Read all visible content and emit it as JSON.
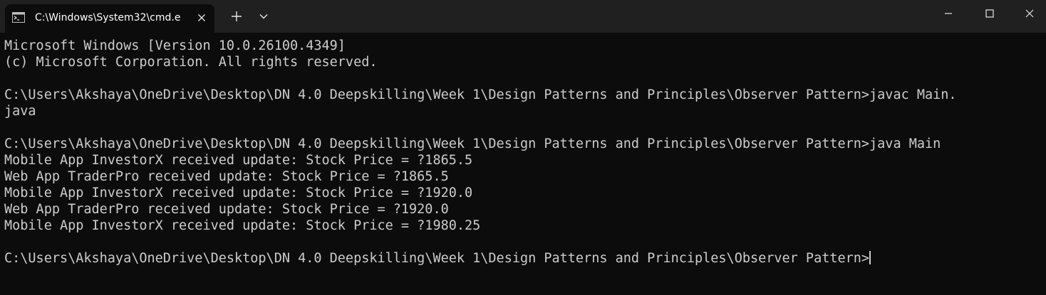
{
  "tab": {
    "icon": "command-prompt-icon",
    "title": "C:\\Windows\\System32\\cmd.e"
  },
  "titlebar_icons": {
    "close_tab": "close-icon",
    "new_tab": "plus-icon",
    "dropdown": "chevron-down-icon",
    "minimize": "minimize-icon",
    "maximize": "maximize-icon",
    "close_window": "close-icon"
  },
  "console": {
    "header": [
      "Microsoft Windows [Version 10.0.26100.4349]",
      "(c) Microsoft Corporation. All rights reserved."
    ],
    "command1": [
      "C:\\Users\\Akshaya\\OneDrive\\Desktop\\DN 4.0 Deepskilling\\Week 1\\Design Patterns and Principles\\Observer Pattern>javac Main.",
      "java"
    ],
    "command2": "C:\\Users\\Akshaya\\OneDrive\\Desktop\\DN 4.0 Deepskilling\\Week 1\\Design Patterns and Principles\\Observer Pattern>java Main",
    "output": [
      "Mobile App InvestorX received update: Stock Price = ?1865.5",
      "Web App TraderPro received update: Stock Price = ?1865.5",
      "Mobile App InvestorX received update: Stock Price = ?1920.0",
      "Web App TraderPro received update: Stock Price = ?1920.0",
      "Mobile App InvestorX received update: Stock Price = ?1980.25"
    ],
    "prompt": "C:\\Users\\Akshaya\\OneDrive\\Desktop\\DN 4.0 Deepskilling\\Week 1\\Design Patterns and Principles\\Observer Pattern>"
  },
  "colors": {
    "background": "#0c0c0c",
    "titlebar": "#202020",
    "text": "#cccccc"
  }
}
